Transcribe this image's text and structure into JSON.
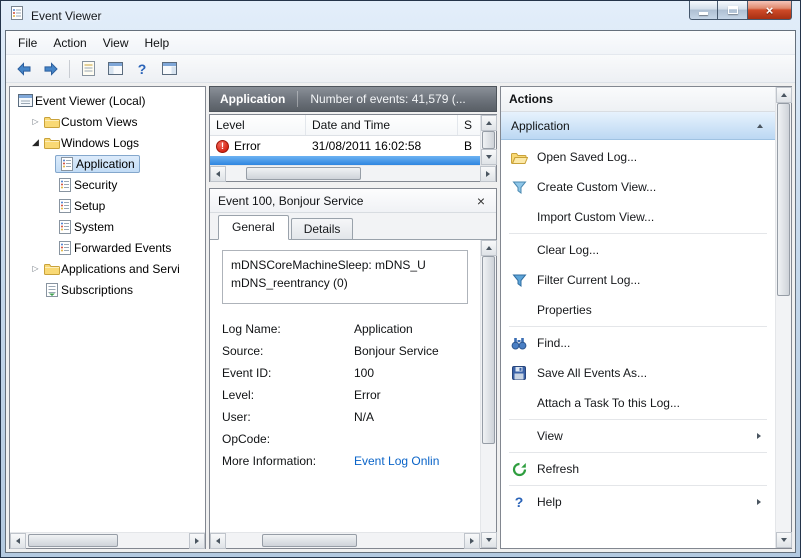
{
  "window": {
    "title": "Event Viewer"
  },
  "menubar": {
    "items": [
      {
        "label": "File"
      },
      {
        "label": "Action"
      },
      {
        "label": "View"
      },
      {
        "label": "Help"
      }
    ]
  },
  "toolbar": {
    "buttons": [
      "back",
      "forward",
      "export-list",
      "show-console-tree",
      "help",
      "show-action-pane"
    ]
  },
  "tree": {
    "root_label": "Event Viewer (Local)",
    "items": [
      {
        "label": "Custom Views",
        "state": "collapsed"
      },
      {
        "label": "Windows Logs",
        "state": "expanded"
      },
      {
        "label": "Application",
        "selected": true
      },
      {
        "label": "Security"
      },
      {
        "label": "Setup"
      },
      {
        "label": "System"
      },
      {
        "label": "Forwarded Events"
      },
      {
        "label": "Applications and Servi",
        "state": "collapsed"
      },
      {
        "label": "Subscriptions"
      }
    ]
  },
  "list": {
    "title": "Application",
    "summary": "Number of events: 41,579 (...",
    "columns": [
      {
        "label": "Level"
      },
      {
        "label": "Date and Time"
      },
      {
        "label": "S"
      }
    ],
    "rows": [
      {
        "level": "Error",
        "datetime": "31/08/2011 16:02:58",
        "source": "B"
      }
    ]
  },
  "detail": {
    "title": "Event 100, Bonjour Service",
    "tabs": [
      {
        "label": "General"
      },
      {
        "label": "Details"
      }
    ],
    "message_line1": "mDNSCoreMachineSleep: mDNS_U",
    "message_line2": "mDNS_reentrancy (0)",
    "fields": [
      {
        "label": "Log Name:",
        "value": "Application"
      },
      {
        "label": "Source:",
        "value": "Bonjour Service"
      },
      {
        "label": "Event ID:",
        "value": "100"
      },
      {
        "label": "Level:",
        "value": "Error"
      },
      {
        "label": "User:",
        "value": "N/A"
      },
      {
        "label": "OpCode:",
        "value": ""
      },
      {
        "label": "More Information:",
        "value": "Event Log Onlin"
      }
    ]
  },
  "actions": {
    "title": "Actions",
    "section_label": "Application",
    "items": [
      {
        "label": "Open Saved Log...",
        "icon": "open-folder-icon"
      },
      {
        "label": "Create Custom View...",
        "icon": "create-custom-view-icon"
      },
      {
        "label": "Import Custom View...",
        "icon": ""
      },
      {
        "label": "Clear Log...",
        "icon": ""
      },
      {
        "label": "Filter Current Log...",
        "icon": "filter-icon"
      },
      {
        "label": "Properties",
        "icon": ""
      },
      {
        "label": "Find...",
        "icon": "find-icon"
      },
      {
        "label": "Save All Events As...",
        "icon": "save-icon"
      },
      {
        "label": "Attach a Task To this Log...",
        "icon": ""
      },
      {
        "label": "View",
        "icon": "",
        "submenu": true
      },
      {
        "label": "Refresh",
        "icon": "refresh-icon"
      },
      {
        "label": "Help",
        "icon": "help-icon",
        "submenu": true
      }
    ]
  },
  "colors": {
    "selection_blue": "#3c8be0",
    "error_red": "#d42313",
    "link_blue": "#0a64c8",
    "header_gray": "#6c727a"
  }
}
